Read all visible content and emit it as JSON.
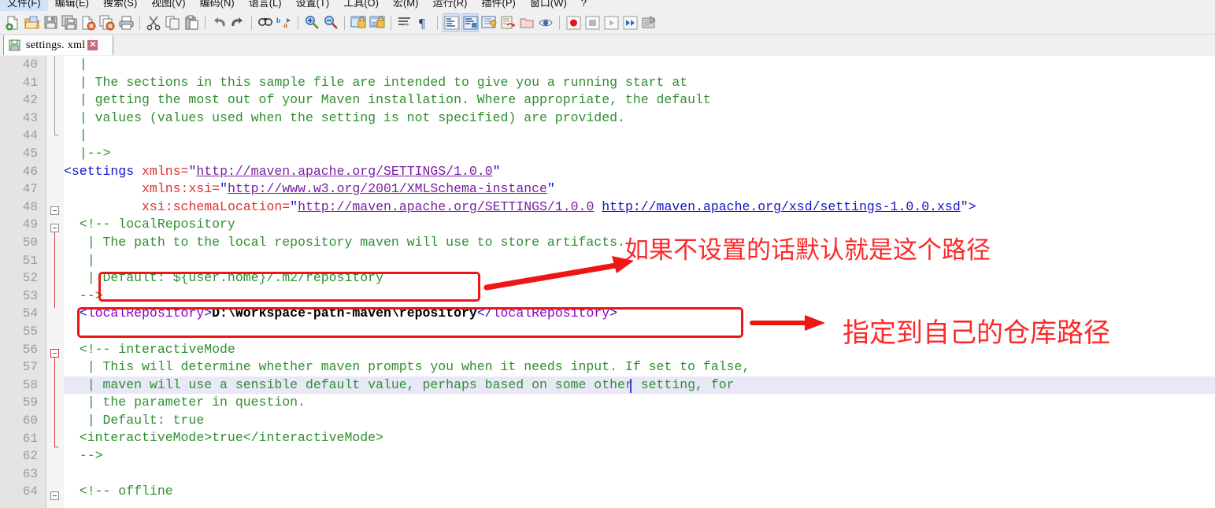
{
  "window": {
    "app": "Notepad++"
  },
  "menubar": {
    "items": [
      {
        "label": "文件(F)",
        "name": "menu-file"
      },
      {
        "label": "编辑(E)",
        "name": "menu-edit"
      },
      {
        "label": "搜索(S)",
        "name": "menu-search"
      },
      {
        "label": "视图(V)",
        "name": "menu-view"
      },
      {
        "label": "编码(N)",
        "name": "menu-encoding"
      },
      {
        "label": "语言(L)",
        "name": "menu-language"
      },
      {
        "label": "设置(T)",
        "name": "menu-settings"
      },
      {
        "label": "工具(O)",
        "name": "menu-tools"
      },
      {
        "label": "宏(M)",
        "name": "menu-macro"
      },
      {
        "label": "运行(R)",
        "name": "menu-run"
      },
      {
        "label": "插件(P)",
        "name": "menu-plugins"
      },
      {
        "label": "窗口(W)",
        "name": "menu-window"
      },
      {
        "label": "?",
        "name": "menu-help"
      }
    ]
  },
  "toolbar": {
    "buttons": [
      "new-file-icon",
      "open-file-icon",
      "save-icon",
      "save-all-icon",
      "close-file-icon",
      "close-all-icon",
      "print-icon",
      "cut-icon",
      "copy-icon",
      "paste-icon",
      "undo-icon",
      "redo-icon",
      "find-icon",
      "replace-icon",
      "zoom-in-icon",
      "zoom-out-icon",
      "sync-vertical-scroll-icon",
      "sync-horizontal-scroll-icon",
      "word-wrap-icon",
      "show-all-characters-icon",
      "show-indent-guide-icon",
      "user-defined-dialog-icon",
      "show-doc-map-icon",
      "function-list-icon",
      "folder-as-workspace-icon",
      "monitoring-icon",
      "record-macro-icon",
      "stop-recording-icon",
      "play-macro-icon",
      "run-macro-multiple-icon",
      "run-icon"
    ]
  },
  "tab": {
    "label": "settings. xml",
    "icon": "save-document-icon",
    "close": "✕"
  },
  "editor": {
    "first_line_number": 40,
    "highlighted_line": 58,
    "lines": [
      {
        "n": 40,
        "segments": [
          {
            "t": "  |",
            "c": "cmt"
          }
        ]
      },
      {
        "n": 41,
        "segments": [
          {
            "t": "  | The sections in this sample file are intended to give you a running start at",
            "c": "cmt"
          }
        ]
      },
      {
        "n": 42,
        "segments": [
          {
            "t": "  | getting the most out of your Maven installation. Where appropriate, the default",
            "c": "cmt"
          }
        ]
      },
      {
        "n": 43,
        "segments": [
          {
            "t": "  | values (values used when the setting is not specified) are provided.",
            "c": "cmt"
          }
        ]
      },
      {
        "n": 44,
        "segments": [
          {
            "t": "  |",
            "c": "cmt"
          }
        ]
      },
      {
        "n": 45,
        "segments": [
          {
            "t": "  |-->",
            "c": "cmt"
          }
        ]
      },
      {
        "n": 46,
        "segments": [
          {
            "t": "<settings ",
            "c": "tagbr"
          },
          {
            "t": "xmlns",
            "c": "attr"
          },
          {
            "t": "=",
            "c": "attr"
          },
          {
            "t": "\"",
            "c": "qt"
          },
          {
            "t": "http://maven.apache.org/SETTINGS/1.0.0",
            "c": "val"
          },
          {
            "t": "\"",
            "c": "qt"
          }
        ]
      },
      {
        "n": 47,
        "segments": [
          {
            "t": "          ",
            "c": "cmt"
          },
          {
            "t": "xmlns:xsi",
            "c": "attr"
          },
          {
            "t": "=",
            "c": "attr"
          },
          {
            "t": "\"",
            "c": "qt"
          },
          {
            "t": "http://www.w3.org/2001/XMLSchema-instance",
            "c": "val"
          },
          {
            "t": "\"",
            "c": "qt"
          }
        ]
      },
      {
        "n": 48,
        "segments": [
          {
            "t": "          ",
            "c": "cmt"
          },
          {
            "t": "xsi:schemaLocation",
            "c": "attr"
          },
          {
            "t": "=",
            "c": "attr"
          },
          {
            "t": "\"",
            "c": "qt"
          },
          {
            "t": "http://maven.apache.org/SETTINGS/1.0.0",
            "c": "val"
          },
          {
            "t": " ",
            "c": "qt"
          },
          {
            "t": "http://maven.apache.org/xsd/settings-1.0.0.xsd",
            "c": "val2"
          },
          {
            "t": "\">",
            "c": "qt"
          }
        ]
      },
      {
        "n": 49,
        "segments": [
          {
            "t": "  <!-- localRepository",
            "c": "cmt"
          }
        ]
      },
      {
        "n": 50,
        "segments": [
          {
            "t": "   | The path to the local repository maven will use to store artifacts.",
            "c": "cmt"
          }
        ]
      },
      {
        "n": 51,
        "segments": [
          {
            "t": "   |",
            "c": "cmt"
          }
        ]
      },
      {
        "n": 52,
        "segments": [
          {
            "t": "   | Default: ${user.home}/.m2/repository",
            "c": "cmt"
          }
        ]
      },
      {
        "n": 53,
        "segments": [
          {
            "t": "  -->",
            "c": "cmt"
          }
        ]
      },
      {
        "n": 54,
        "segments": [
          {
            "t": "  <",
            "c": "tagbr"
          },
          {
            "t": "localRepository",
            "c": "tagname"
          },
          {
            "t": ">",
            "c": "tagbr"
          },
          {
            "t": "D:\\Workspace-path-maven\\repository",
            "c": "txt"
          },
          {
            "t": "</",
            "c": "tagbr"
          },
          {
            "t": "localRepository",
            "c": "tagname"
          },
          {
            "t": ">",
            "c": "tagbr"
          }
        ]
      },
      {
        "n": 55,
        "segments": [
          {
            "t": "",
            "c": "cmt"
          }
        ]
      },
      {
        "n": 56,
        "segments": [
          {
            "t": "  <!-- interactiveMode",
            "c": "cmt"
          }
        ]
      },
      {
        "n": 57,
        "segments": [
          {
            "t": "   | This will determine whether maven prompts you when it needs input. If set to false,",
            "c": "cmt"
          }
        ]
      },
      {
        "n": 58,
        "segments": [
          {
            "t": "   | maven will use a sensible default value, perhaps based on some other setting, for",
            "c": "cmt"
          }
        ]
      },
      {
        "n": 59,
        "segments": [
          {
            "t": "   | the parameter in question.",
            "c": "cmt"
          }
        ]
      },
      {
        "n": 60,
        "segments": [
          {
            "t": "   | Default: true",
            "c": "cmt"
          }
        ]
      },
      {
        "n": 61,
        "segments": [
          {
            "t": "  <interactiveMode>true</interactiveMode>",
            "c": "cmt"
          }
        ]
      },
      {
        "n": 62,
        "segments": [
          {
            "t": "  -->",
            "c": "cmt"
          }
        ]
      },
      {
        "n": 63,
        "segments": [
          {
            "t": "",
            "c": "cmt"
          }
        ]
      },
      {
        "n": 64,
        "segments": [
          {
            "t": "  <!-- offline",
            "c": "cmt"
          }
        ]
      }
    ]
  },
  "annotations": [
    {
      "name": "annotation-default-path",
      "text": "如果不设置的话默认就是这个路径"
    },
    {
      "name": "annotation-custom-repo-path",
      "text": "指定到自己的仓库路径"
    }
  ],
  "colors": {
    "annotation_red": "#fb2a2a",
    "comment_green": "#2f8f2f",
    "tag_blue": "#1414c8",
    "tag_purple": "#8b00c8",
    "attr_red": "#e03030",
    "tab_active_orange": "#f5a623",
    "current_line_highlight": "#e8e8f7"
  }
}
